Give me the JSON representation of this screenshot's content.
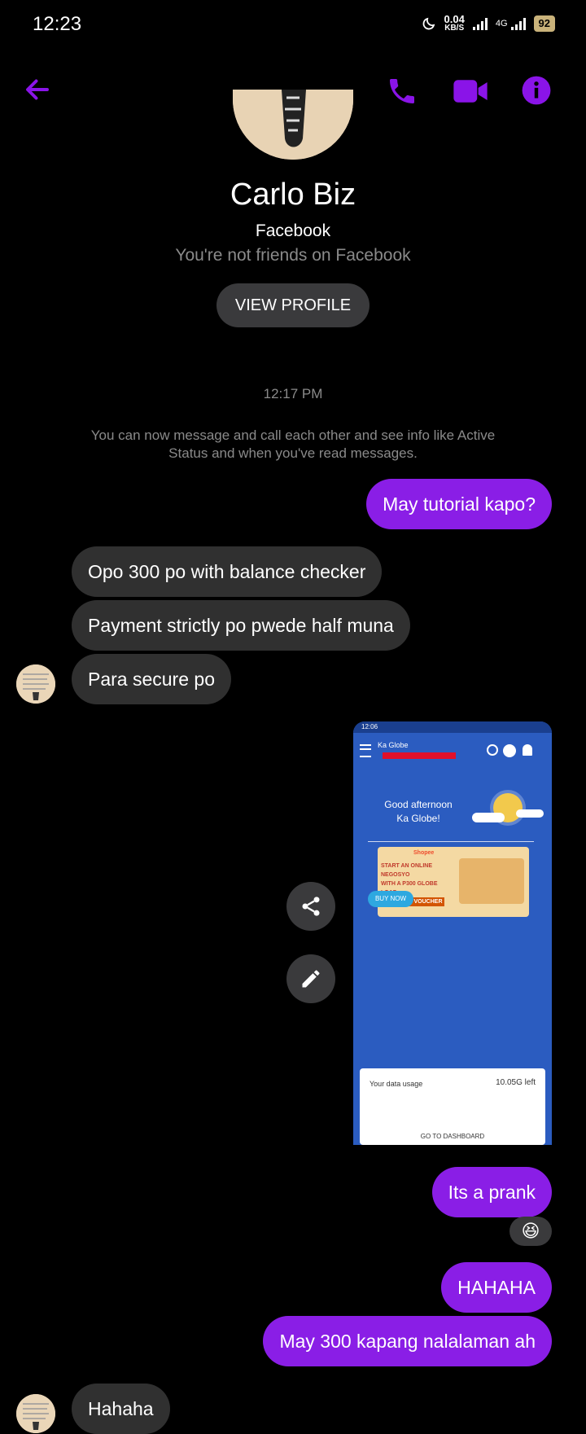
{
  "status": {
    "time": "12:23",
    "net_speed": "0.04",
    "net_unit": "KB/S",
    "network": "4G",
    "battery": "92"
  },
  "header": {
    "back_icon": "arrow-left-icon",
    "call_icon": "phone-icon",
    "video_icon": "video-camera-icon",
    "info_icon": "info-icon",
    "accent": "#8a14e8"
  },
  "profile": {
    "name": "Carlo Biz",
    "platform": "Facebook",
    "relationship": "You're not friends on Facebook",
    "view_profile_label": "VIEW PROFILE"
  },
  "conversation": {
    "timestamp": "12:17 PM",
    "notice": "You can now message and call each other and see info like Active Status and when you've read messages.",
    "messages": [
      {
        "from": "me",
        "text": "May tutorial kapo?"
      },
      {
        "from": "them",
        "text": "Opo 300 po with balance checker"
      },
      {
        "from": "them",
        "text": "Payment strictly po pwede half muna"
      },
      {
        "from": "them",
        "text": "Para secure po"
      },
      {
        "from": "me",
        "text": "Its a prank"
      },
      {
        "from": "me",
        "text": "HAHAHA"
      },
      {
        "from": "me",
        "text": "May 300 kapang nalalaman ah"
      },
      {
        "from": "them",
        "text": "Hahaha"
      }
    ],
    "reaction": "😆"
  },
  "shared_image": {
    "time": "12:06",
    "brand": "Ka Globe",
    "greeting_line1": "Good afternoon",
    "greeting_line2": "Ka Globe!",
    "promo_brand": "Shopee",
    "promo_line1": "START AN ONLINE NEGOSYO",
    "promo_line2": "WITH A P300 GLOBE LOAD",
    "promo_line3": "DISCOUNT VOUCHER",
    "buy_now": "BUY NOW",
    "usage_label": "Your data usage",
    "usage_value": "10.05G left",
    "dashboard_label": "GO TO DASHBOARD"
  },
  "actions": {
    "share_icon": "share-icon",
    "edit_icon": "pencil-icon"
  }
}
